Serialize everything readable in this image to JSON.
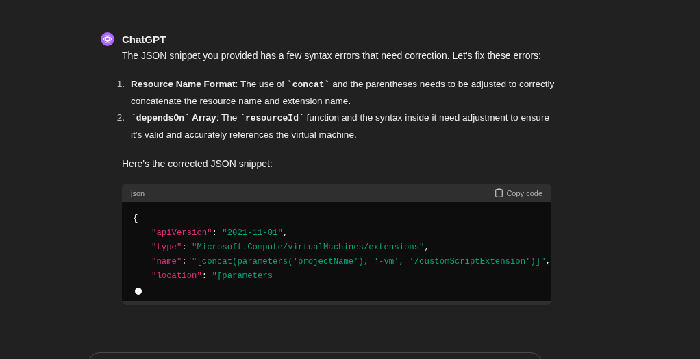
{
  "message": {
    "author": "ChatGPT",
    "intro": "The JSON snippet you provided has a few syntax errors that need correction. Let's fix these errors:",
    "list": [
      {
        "number": "1.",
        "segments": [
          {
            "kind": "bold",
            "text": "Resource Name Format"
          },
          {
            "kind": "text",
            "text": ": The use of "
          },
          {
            "kind": "code",
            "text": "`concat`"
          },
          {
            "kind": "text",
            "text": " and the parentheses needs to be adjusted to correctly concatenate the resource name and extension name."
          }
        ]
      },
      {
        "number": "2.",
        "segments": [
          {
            "kind": "code",
            "text": "`dependsOn`"
          },
          {
            "kind": "bold",
            "text": " Array"
          },
          {
            "kind": "text",
            "text": ": The "
          },
          {
            "kind": "code",
            "text": "`resourceId`"
          },
          {
            "kind": "text",
            "text": " function and the syntax inside it need adjustment to ensure it's valid and accurately references the virtual machine."
          }
        ]
      }
    ],
    "outro": "Here's the corrected JSON snippet:",
    "code_block": {
      "language": "json",
      "copy_label": "Copy code",
      "streaming": true,
      "lines": [
        {
          "tokens": [
            {
              "kind": "punct",
              "text": "{"
            }
          ],
          "children": [
            {
              "tokens": [
                {
                  "kind": "key",
                  "text": "\"apiVersion\""
                },
                {
                  "kind": "punct",
                  "text": ": "
                },
                {
                  "kind": "string",
                  "text": "\"2021-11-01\""
                },
                {
                  "kind": "punct",
                  "text": ","
                }
              ]
            },
            {
              "tokens": [
                {
                  "kind": "key",
                  "text": "\"type\""
                },
                {
                  "kind": "punct",
                  "text": ": "
                },
                {
                  "kind": "string",
                  "text": "\"Microsoft.Compute/virtualMachines/extensions\""
                },
                {
                  "kind": "punct",
                  "text": ","
                }
              ]
            },
            {
              "tokens": [
                {
                  "kind": "key",
                  "text": "\"name\""
                },
                {
                  "kind": "punct",
                  "text": ": "
                },
                {
                  "kind": "string",
                  "text": "\"[concat(parameters('projectName'), '-vm', '/customScriptExtension')]\""
                },
                {
                  "kind": "punct",
                  "text": ","
                }
              ]
            },
            {
              "tokens": [
                {
                  "kind": "key",
                  "text": "\"location\""
                },
                {
                  "kind": "punct",
                  "text": ": "
                },
                {
                  "kind": "string",
                  "text": "\"[parameters"
                }
              ]
            }
          ]
        }
      ]
    }
  }
}
